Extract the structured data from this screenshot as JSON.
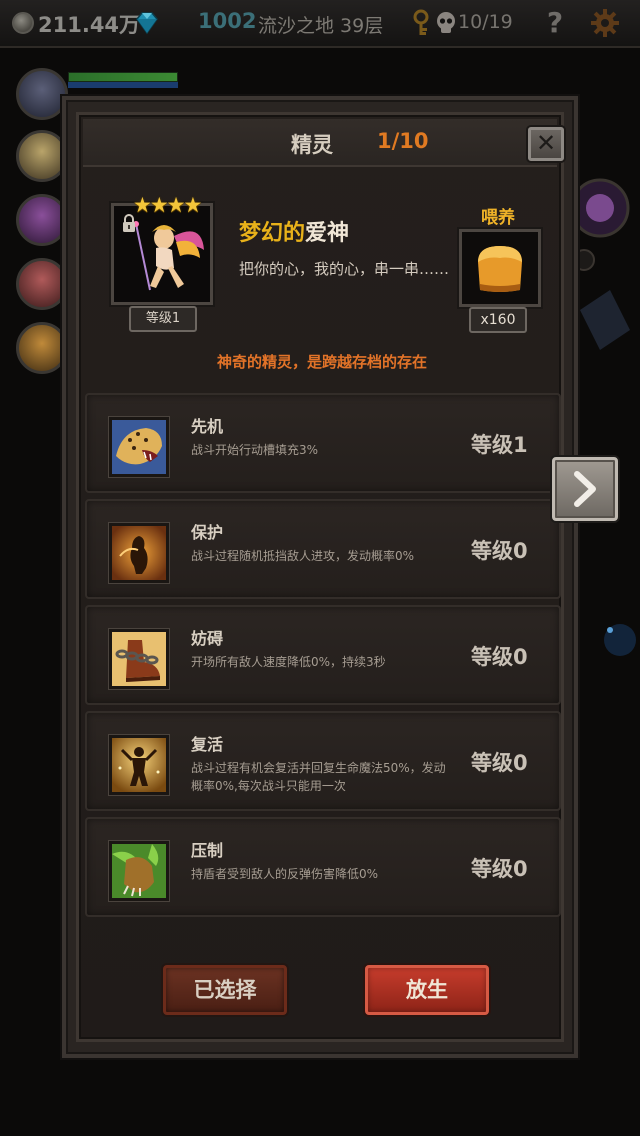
{
  "top_bar": {
    "gold": "211.44万",
    "gems": "1002",
    "floor": "流沙之地 39层",
    "keys": "10/19",
    "help_label": "?"
  },
  "modal": {
    "title": "精灵",
    "page": "1/10",
    "close_label": "✕",
    "spirit": {
      "stars": "★★★★",
      "level": "等级1",
      "name_prefix": "梦幻的",
      "name_suffix": "爱神",
      "description": "把你的心，我的心，串一串……",
      "feed_label": "喂养",
      "feed_count": "x160",
      "tagline": "神奇的精灵，是跨越存档的存在"
    },
    "skills": [
      {
        "title": "先机",
        "desc": "战斗开始行动槽填充3%",
        "level": "等级1",
        "icon": "leopard-icon"
      },
      {
        "title": "保护",
        "desc": "战斗过程随机抵挡敌人进攻，发动概率0%",
        "level": "等级0",
        "icon": "shield-warrior-icon"
      },
      {
        "title": "妨碍",
        "desc": "开场所有敌人速度降低0%，持续3秒",
        "level": "等级0",
        "icon": "chained-boot-icon"
      },
      {
        "title": "复活",
        "desc": "战斗过程有机会复活并回复生命魔法50%，发动概率0%,每次战斗只能用一次",
        "level": "等级0",
        "icon": "revive-figure-icon"
      },
      {
        "title": "压制",
        "desc": "持盾者受到敌人的反弹伤害降低0%",
        "level": "等级0",
        "icon": "beast-claw-icon"
      }
    ],
    "buttons": {
      "selected": "已选择",
      "release": "放生"
    }
  },
  "colors": {
    "accent_orange": "#e07a22",
    "gold_name": "#e9b21a",
    "release_red": "#c63c2c"
  }
}
